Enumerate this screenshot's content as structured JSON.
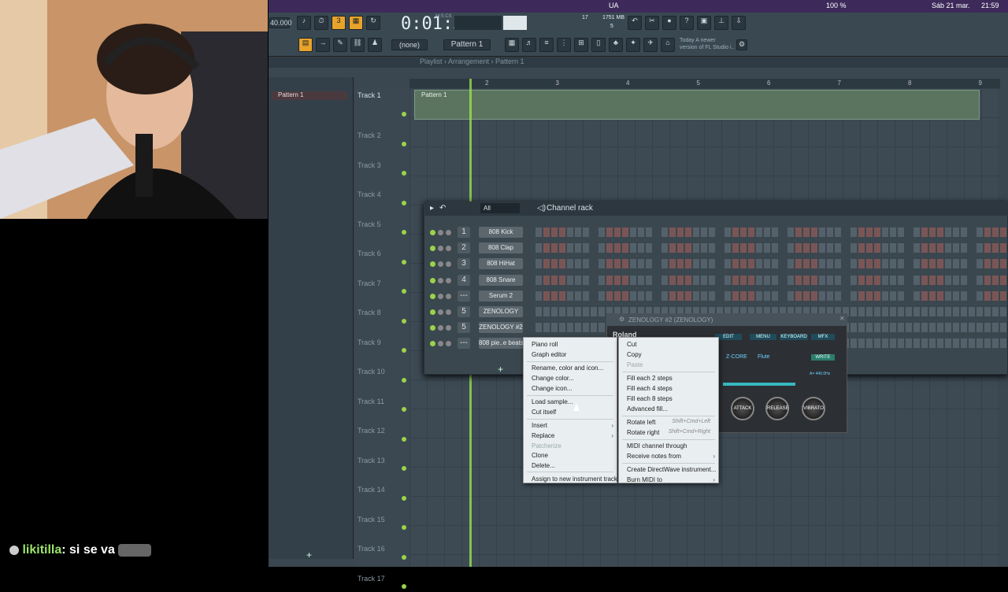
{
  "chat": {
    "user": "likitilla",
    "message": ": si se va"
  },
  "menubar": {
    "lang": "UA",
    "battery": "100 %",
    "date": "Sáb 21 mar.",
    "time": "21:59"
  },
  "toolbar": {
    "bpm": "40.000",
    "time": "0:01:39",
    "time_sub": "M:S:CS",
    "cpu": "17",
    "mem": "1751 MB",
    "voices": "5",
    "pattern": "Pattern 1",
    "snap": "(none)",
    "news_line1": "Today  A newer",
    "news_line2": "version of FL Studio i.."
  },
  "playlist": {
    "breadcrumb": "Playlist › Arrangement › Pattern 1",
    "pattern_item": "Pattern 1",
    "clip_label": "Pattern 1",
    "ruler": [
      "2",
      "3",
      "4",
      "5",
      "6",
      "7",
      "8",
      "9"
    ],
    "tracks": [
      "Track 1",
      "Track 2",
      "Track 3",
      "Track 4",
      "Track 5",
      "Track 6",
      "Track 7",
      "Track 8",
      "Track 9",
      "Track 10",
      "Track 11",
      "Track 12",
      "Track 13",
      "Track 14",
      "Track 15",
      "Track 16",
      "Track 17"
    ]
  },
  "channel_rack": {
    "title": "Channel rack",
    "filter": "All",
    "channels": [
      {
        "num": "1",
        "name": "808 Kick",
        "color": "red"
      },
      {
        "num": "2",
        "name": "808 Clap",
        "color": "red"
      },
      {
        "num": "3",
        "name": "808 HiHat",
        "color": "red"
      },
      {
        "num": "4",
        "name": "808 Snare",
        "color": "red"
      },
      {
        "num": "---",
        "name": "Serum 2",
        "color": "red"
      },
      {
        "num": "5",
        "name": "ZENOLOGY",
        "color": "grey"
      },
      {
        "num": "5",
        "name": "ZENOLOGY #2",
        "color": "grey"
      },
      {
        "num": "---",
        "name": "808 pie..e beats",
        "color": "grey"
      }
    ],
    "add": "+"
  },
  "zenology": {
    "title": "ZENOLOGY #2 (ZENOLOGY)",
    "brand": "Roland",
    "edit": "EDIT",
    "menu": "MENU",
    "keyboard": "KEYBOARD",
    "mfx": "MFX",
    "core": "Z-CORE",
    "patch": "Flute",
    "write": "WRITE",
    "tune": "A= 440.0Hz",
    "knobs": [
      "ATTACK",
      "RELEASE",
      "VIBRATO"
    ]
  },
  "menu_left": [
    "Piano roll",
    "Graph editor",
    "Rename, color and icon...",
    "Change color...",
    "Change icon...",
    "Load sample...",
    "Cut itself",
    "Insert",
    "Replace",
    "Patcherize",
    "Clone",
    "Delete...",
    "Assign to new instrument track"
  ],
  "menu_right": {
    "items": [
      "Cut",
      "Copy",
      "Paste",
      "Fill each 2 steps",
      "Fill each 4 steps",
      "Fill each 8 steps",
      "Advanced fill...",
      "Rotate left",
      "Rotate right",
      "MIDI channel through",
      "Receive notes from",
      "Create DirectWave instrument...",
      "Burn MIDI to"
    ],
    "shortcuts": {
      "rotate_left": "Shift+Cmd+Left",
      "rotate_right": "Shift+Cmd+Right"
    }
  }
}
